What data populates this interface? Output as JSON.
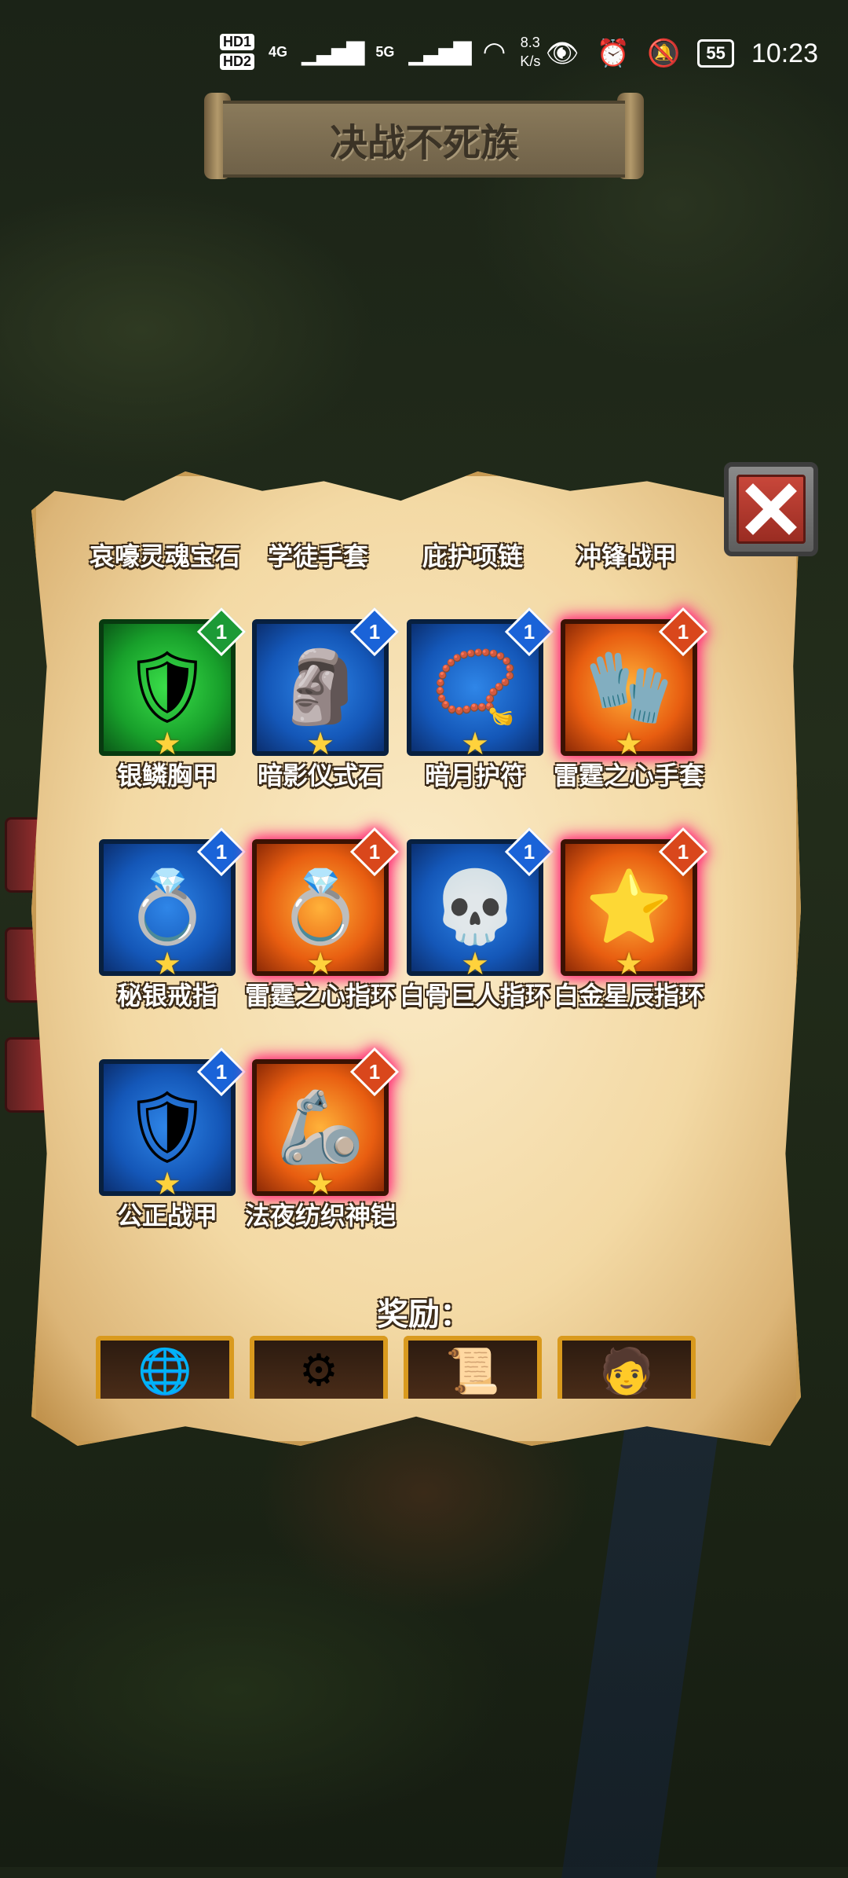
{
  "status_bar": {
    "hd1": "HD1",
    "hd2": "HD2",
    "net1": "4G",
    "net2": "5G",
    "speed_value": "8.3",
    "speed_unit": "K/s",
    "battery": "55",
    "time": "10:23"
  },
  "title": "决战不死族",
  "header_labels": [
    "哀嚎灵魂宝石",
    "学徒手套",
    "庇护项链",
    "冲锋战甲"
  ],
  "items": [
    {
      "name": "银鳞胸甲",
      "rarity": "green",
      "level": "1",
      "icon": "chest-armor-icon",
      "glyph": "🛡"
    },
    {
      "name": "暗影仪式石",
      "rarity": "blue",
      "level": "1",
      "icon": "ritual-stone-icon",
      "glyph": "🗿"
    },
    {
      "name": "暗月护符",
      "rarity": "blue",
      "level": "1",
      "icon": "amulet-icon",
      "glyph": "📿"
    },
    {
      "name": "雷霆之心手套",
      "rarity": "orange",
      "level": "1",
      "icon": "gauntlet-icon",
      "glyph": "🧤"
    },
    {
      "name": "秘银戒指",
      "rarity": "blue",
      "level": "1",
      "icon": "ring-icon",
      "glyph": "💍"
    },
    {
      "name": "雷霆之心指环",
      "rarity": "orange",
      "level": "1",
      "icon": "ring-icon",
      "glyph": "💍"
    },
    {
      "name": "白骨巨人指环",
      "rarity": "blue",
      "level": "1",
      "icon": "skull-ring-icon",
      "glyph": "💀"
    },
    {
      "name": "白金星辰指环",
      "rarity": "orange",
      "level": "1",
      "icon": "star-ring-icon",
      "glyph": "⭐"
    },
    {
      "name": "公正战甲",
      "rarity": "blue",
      "level": "1",
      "icon": "blue-armor-icon",
      "glyph": "🛡"
    },
    {
      "name": "法夜纺织神铠",
      "rarity": "orange",
      "level": "1",
      "icon": "bracer-icon",
      "glyph": "🦾"
    }
  ],
  "rewards_label": "奖励：",
  "rewards": [
    {
      "icon": "globe-icon",
      "glyph": "🌐"
    },
    {
      "icon": "metal-bar-icon",
      "glyph": "⚙"
    },
    {
      "icon": "scroll-icon",
      "glyph": "📜"
    },
    {
      "icon": "hero-portrait-icon",
      "glyph": "🧑"
    }
  ],
  "colors": {
    "rarity_blue": "#1457b8",
    "rarity_green": "#18a02b",
    "rarity_orange": "#e85d10",
    "parchment": "#f3d9a4",
    "close_red": "#c8473a"
  }
}
